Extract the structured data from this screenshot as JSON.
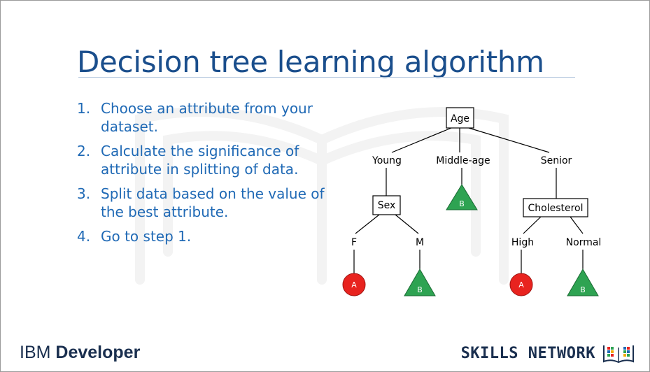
{
  "slide": {
    "title": "Decision tree learning algorithm",
    "steps": [
      {
        "number": "1.",
        "text": "Choose an attribute from your dataset."
      },
      {
        "number": "2.",
        "text": "Calculate the significance of attribute in splitting of data."
      },
      {
        "number": "3.",
        "text": "Split data based on the value of the best attribute."
      },
      {
        "number": "4.",
        "text": "Go to step 1."
      }
    ]
  },
  "tree": {
    "root": "Age",
    "age_branches": [
      "Young",
      "Middle-age",
      "Senior"
    ],
    "sex_node": "Sex",
    "sex_branches": [
      "F",
      "M"
    ],
    "cholesterol_node": "Cholesterol",
    "cholesterol_branches": [
      "High",
      "Normal"
    ],
    "leaf_labels": {
      "middle_age": "B",
      "female": "A",
      "male": "B",
      "high": "A",
      "normal": "B"
    },
    "colors": {
      "leaf_a": "#e8231f",
      "leaf_b": "#2ea352",
      "line": "#000000"
    }
  },
  "footer": {
    "ibm_prefix": "IBM",
    "ibm_suffix": "Developer",
    "skills": "SKILLS NETWORK"
  },
  "colors": {
    "title": "#1a4e8c",
    "steps": "#1f69b5",
    "footer_text": "#1a2f4f"
  }
}
